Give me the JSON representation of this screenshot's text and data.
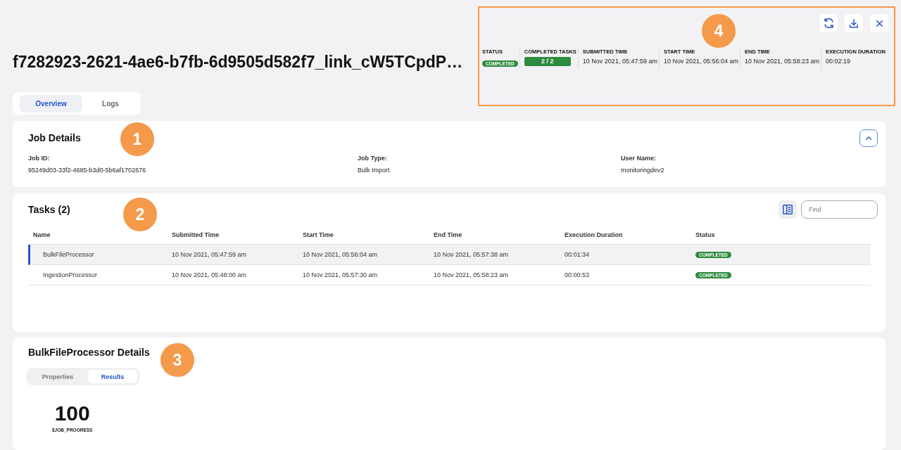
{
  "header": {
    "title": "f7282923-2621-4ae6-b7fb-6d9505d582f7_link_cW5TCpdP…"
  },
  "summary": {
    "highlighted": true,
    "callout": "4",
    "stats": [
      {
        "kind": "badge",
        "label": "STATUS",
        "value": "COMPLETED"
      },
      {
        "kind": "progress",
        "label": "COMPLETED TASKS",
        "value": "2 / 2",
        "level": 1
      },
      {
        "kind": "text",
        "label": "SUBMITTED TIME",
        "value": "10 Nov 2021, 05:47:59 am"
      },
      {
        "kind": "text",
        "label": "START TIME",
        "value": "10 Nov 2021, 05:56:04 am"
      },
      {
        "kind": "text",
        "label": "END TIME",
        "value": "10 Nov 2021, 05:58:23 am"
      },
      {
        "kind": "text",
        "label": "EXECUTION DURATION",
        "value": "00:02:19"
      }
    ]
  },
  "tabs": [
    {
      "label": "Overview",
      "selected": true
    },
    {
      "label": "Logs",
      "selected": false
    }
  ],
  "job_details": {
    "title": "Job Details",
    "callout": "1",
    "expanded": true,
    "fields": [
      {
        "label": "Job ID:",
        "value": "95249d03-33f2-4685-b3d0-5b6af1702676"
      },
      {
        "label": "Job Type:",
        "value": "Bulk Import"
      },
      {
        "label": "User Name:",
        "value": "monitoringdev2"
      }
    ]
  },
  "tasks": {
    "title": "Tasks (2)",
    "callout": "2",
    "search": {
      "placeholder": "Find"
    },
    "columns": [
      "Name",
      "Submitted Time",
      "Start Time",
      "End Time",
      "Execution Duration",
      "Status"
    ],
    "rows": [
      {
        "selected": true,
        "cells": [
          "BulkFileProcessor",
          "10 Nov 2021, 05:47:59 am",
          "10 Nov 2021, 05:56:04 am",
          "10 Nov 2021, 05:57:38 am",
          "00:01:34"
        ],
        "status": "COMPLETED"
      },
      {
        "selected": false,
        "cells": [
          "IngestionProcessor",
          "10 Nov 2021, 05:48:00 am",
          "10 Nov 2021, 05:57:30 am",
          "10 Nov 2021, 05:58:23 am",
          "00:00:53"
        ],
        "status": "COMPLETED"
      }
    ]
  },
  "details": {
    "title": "BulkFileProcessor Details",
    "callout": "3",
    "tabs": [
      {
        "label": "Properties",
        "selected": false
      },
      {
        "label": "Results",
        "selected": true
      }
    ],
    "result": {
      "value": "100",
      "label": "$JOB_PROGRESS"
    }
  }
}
